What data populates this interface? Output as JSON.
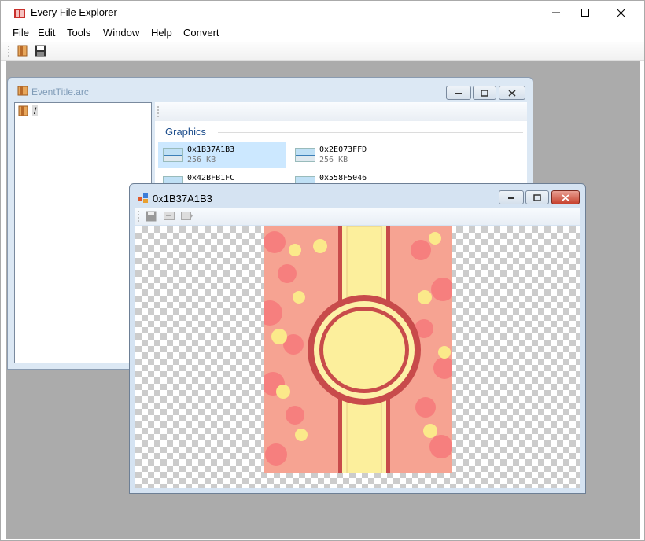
{
  "app": {
    "title": "Every File Explorer"
  },
  "menu": [
    "File",
    "Edit",
    "Tools",
    "Window",
    "Help",
    "Convert"
  ],
  "toolbar": {
    "icons": [
      "open-archive-icon",
      "save-icon"
    ]
  },
  "arc_window": {
    "title": "EventTitle.arc",
    "tree_root": "/",
    "group_label": "Graphics",
    "files": [
      {
        "name": "0x1B37A1B3",
        "size": "256 KB",
        "selected": true
      },
      {
        "name": "0x2E073FFD",
        "size": "256 KB",
        "selected": false
      },
      {
        "name": "0x42BFB1FC",
        "size": "",
        "selected": false
      },
      {
        "name": "0x558F5046",
        "size": "",
        "selected": false
      }
    ]
  },
  "image_window": {
    "title": "0x1B37A1B3",
    "toolbar_icons": [
      "save-icon",
      "export-icon",
      "import-icon"
    ],
    "colors": {
      "outer": "#f6a392",
      "inner": "#fdf1a8",
      "border": "#c84b4b",
      "heart_pink": "#f7777a",
      "heart_yellow": "#fbe98a"
    }
  }
}
